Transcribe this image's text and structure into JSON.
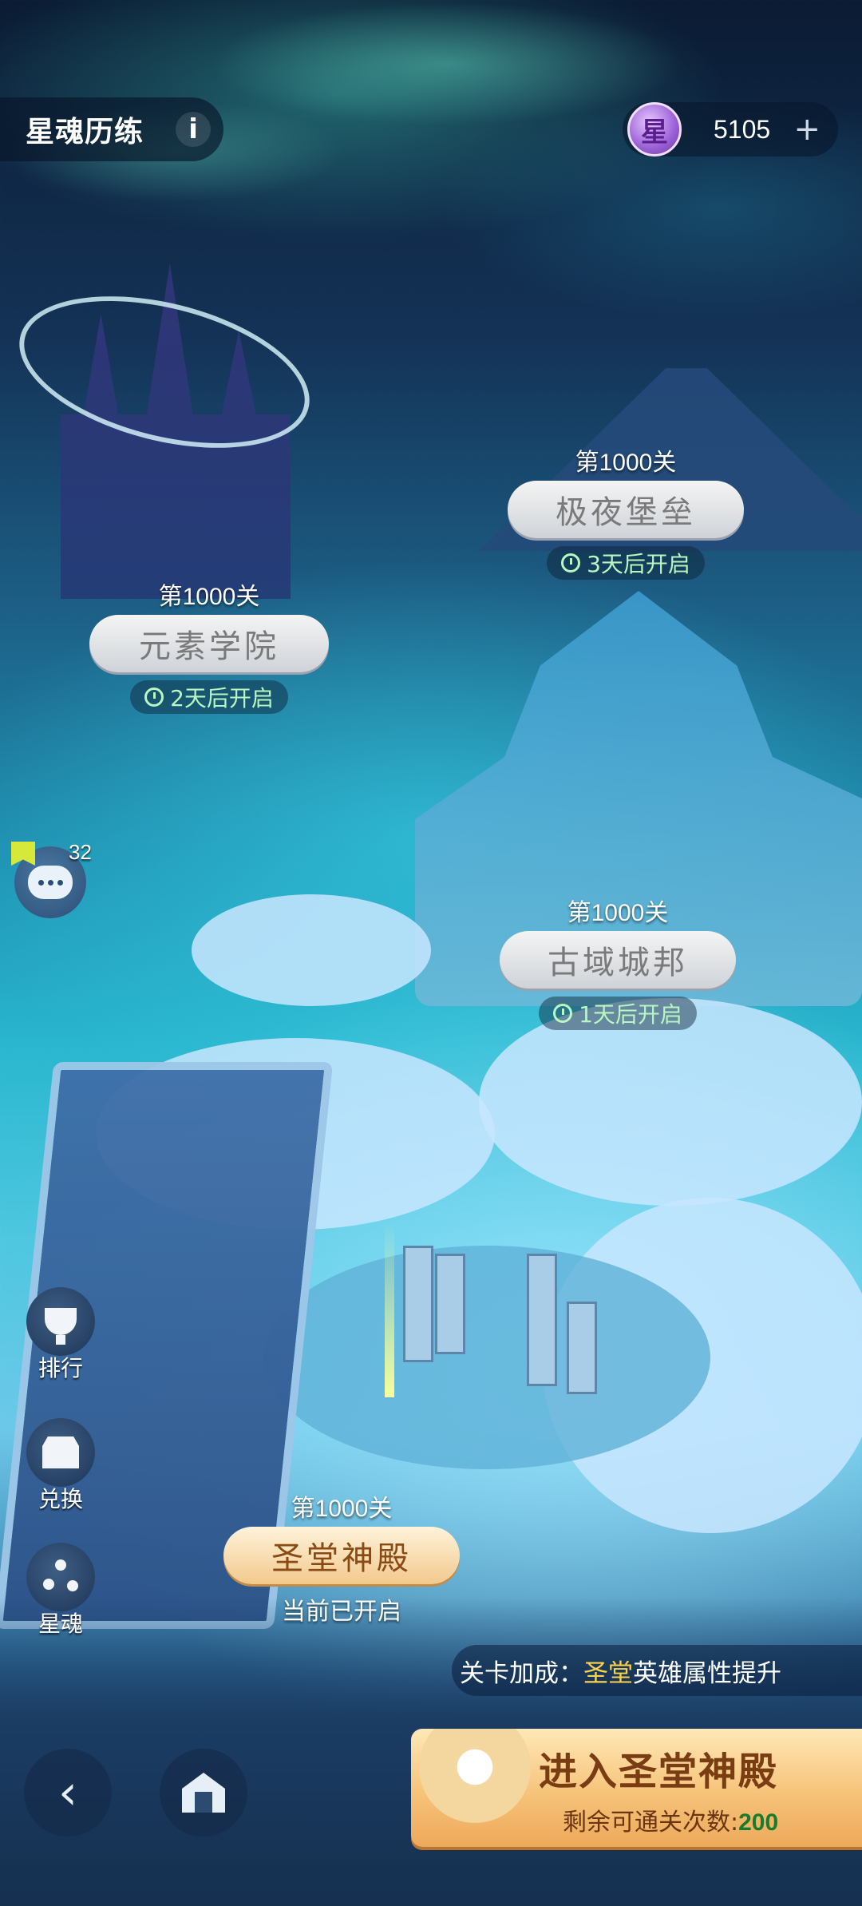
{
  "header": {
    "title": "星魂历练",
    "info_glyph": "i",
    "currency_icon_glyph": "星",
    "currency_value": "5105",
    "plus_glyph": "+"
  },
  "stages": [
    {
      "level": "第1000关",
      "name": "元素学院",
      "status": "2天后开启",
      "state": "locked"
    },
    {
      "level": "第1000关",
      "name": "极夜堡垒",
      "status": "3天后开启",
      "state": "locked"
    },
    {
      "level": "第1000关",
      "name": "古域城邦",
      "status": "1天后开启",
      "state": "locked"
    },
    {
      "level": "第1000关",
      "name": "圣堂神殿",
      "status": "当前已开启",
      "state": "open"
    }
  ],
  "chat": {
    "badge_count": "32"
  },
  "side_menu": [
    {
      "label": "排行",
      "icon": "trophy-icon"
    },
    {
      "label": "兑换",
      "icon": "shop-icon"
    },
    {
      "label": "星魂",
      "icon": "star-soul-icon"
    }
  ],
  "bonus": {
    "prefix": "关卡加成：",
    "highlight": "圣堂",
    "suffix": "英雄属性提升"
  },
  "enter_button": {
    "title": "进入圣堂神殿",
    "remaining_label": "剩余可通关次数:",
    "remaining_count": "200"
  },
  "nav": {
    "back_glyph": "‹"
  },
  "colors": {
    "open_plaque": "#f2c98d",
    "locked_plaque": "#cfd3d8",
    "countdown_green": "#b8f7c0",
    "highlight_yellow": "#ffd24a",
    "remaining_green": "#1b7b2c"
  }
}
